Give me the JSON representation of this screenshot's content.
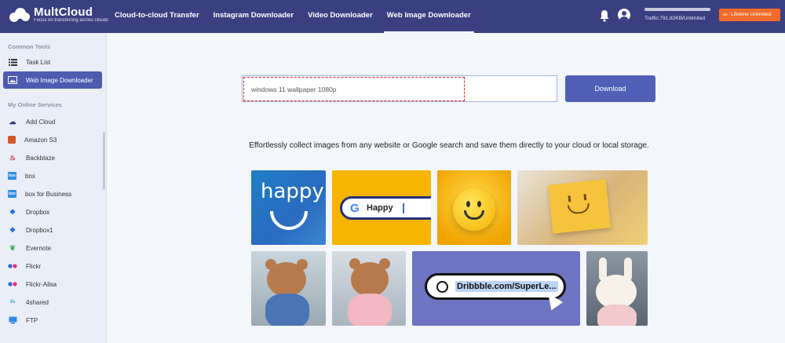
{
  "header": {
    "brand": "MultCloud",
    "brand_tagline": "Focus on transferring across clouds",
    "nav": [
      {
        "label": "Cloud-to-cloud Transfer",
        "active": false
      },
      {
        "label": "Instagram Downloader",
        "active": false
      },
      {
        "label": "Video Downloader",
        "active": false
      },
      {
        "label": "Web Image Downloader",
        "active": true
      }
    ],
    "traffic": "Traffic:791.82KB/Unlimited",
    "upgrade_label": "Lifetime Unlimited"
  },
  "sidebar": {
    "common_tools_title": "Common Tools",
    "common_tools": [
      {
        "label": "Task List",
        "icon": "list-icon"
      },
      {
        "label": "Web Image Downloader",
        "icon": "image-icon",
        "active": true
      }
    ],
    "services_title": "My Online Services",
    "services": [
      {
        "label": "Add Cloud",
        "icon": "add-cloud-icon"
      },
      {
        "label": "Amazon S3",
        "icon": "amazon-s3-icon"
      },
      {
        "label": "Backblaze",
        "icon": "backblaze-icon"
      },
      {
        "label": "box",
        "icon": "box-icon"
      },
      {
        "label": "box for Business",
        "icon": "box-business-icon"
      },
      {
        "label": "Dropbox",
        "icon": "dropbox-icon"
      },
      {
        "label": "Dropbox1",
        "icon": "dropbox-icon"
      },
      {
        "label": "Evernote",
        "icon": "evernote-icon"
      },
      {
        "label": "Flickr",
        "icon": "flickr-icon"
      },
      {
        "label": "Flickr-Ailsa",
        "icon": "flickr-icon"
      },
      {
        "label": "4shared",
        "icon": "4shared-icon"
      },
      {
        "label": "FTP",
        "icon": "ftp-icon"
      }
    ]
  },
  "main": {
    "search_value": "windows 11 wallpaper 1080p",
    "download_label": "Download",
    "tagline": "Effortlessly collect images from any website or Google search and save them directly to your cloud or local storage.",
    "tiles": {
      "happy_text": "happy",
      "google_query": "Happy",
      "google_g": "G",
      "dribbble_url": "Dribbble.com/SuperLe..."
    }
  },
  "colors": {
    "topbar": "#3a3f82",
    "accent": "#5160b6",
    "upgrade": "#f26b2a"
  }
}
